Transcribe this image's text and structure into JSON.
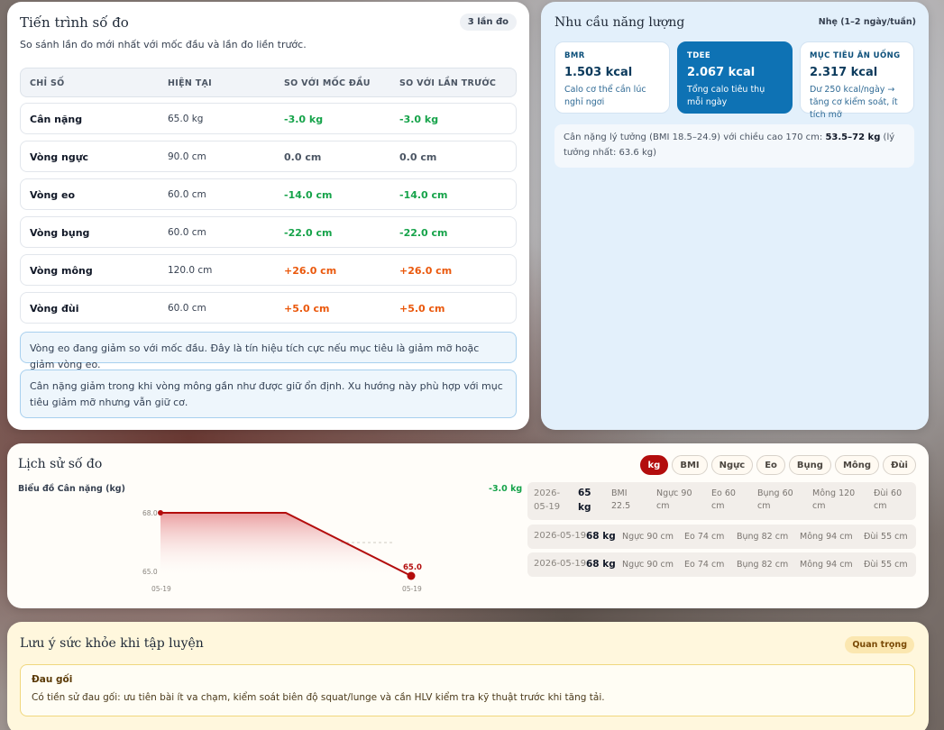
{
  "progress": {
    "title": "Tiến trình số đo",
    "badge": "3 lần đo",
    "subtitle": "So sánh lần đo mới nhất với mốc đầu và lần đo liền trước.",
    "headers": [
      "CHỈ SỐ",
      "HIỆN TẠI",
      "SO VỚI MỐC ĐẦU",
      "SO VỚI LẦN TRƯỚC"
    ],
    "rows": [
      {
        "name": "Cân nặng",
        "current": "65.0 kg",
        "vs_start": "-3.0 kg",
        "vs_prev": "-3.0 kg",
        "trend": "neg"
      },
      {
        "name": "Vòng ngực",
        "current": "90.0 cm",
        "vs_start": "0.0 cm",
        "vs_prev": "0.0 cm",
        "trend": "zero"
      },
      {
        "name": "Vòng eo",
        "current": "60.0 cm",
        "vs_start": "-14.0 cm",
        "vs_prev": "-14.0 cm",
        "trend": "neg"
      },
      {
        "name": "Vòng bụng",
        "current": "60.0 cm",
        "vs_start": "-22.0 cm",
        "vs_prev": "-22.0 cm",
        "trend": "neg"
      },
      {
        "name": "Vòng mông",
        "current": "120.0 cm",
        "vs_start": "+26.0 cm",
        "vs_prev": "+26.0 cm",
        "trend": "pos"
      },
      {
        "name": "Vòng đùi",
        "current": "60.0 cm",
        "vs_start": "+5.0 cm",
        "vs_prev": "+5.0 cm",
        "trend": "pos"
      }
    ],
    "notes": [
      "Vòng eo đang giảm so với mốc đầu. Đây là tín hiệu tích cực nếu mục tiêu là giảm mỡ hoặc giảm vòng eo.",
      "Cân nặng giảm trong khi vòng mông gần như được giữ ổn định. Xu hướng này phù hợp với mục tiêu giảm mỡ nhưng vẫn giữ cơ."
    ]
  },
  "energy": {
    "title": "Nhu cầu năng lượng",
    "level": "Nhẹ (1–2 ngày/tuần)",
    "boxes": [
      {
        "label": "BMR",
        "value": "1.503 kcal",
        "desc": "Calo cơ thể cần lúc nghỉ ngơi",
        "active": false
      },
      {
        "label": "TDEE",
        "value": "2.067 kcal",
        "desc": "Tổng calo tiêu thụ mỗi ngày",
        "active": true
      },
      {
        "label": "MỤC TIÊU ĂN UỐNG",
        "value": "2.317 kcal",
        "desc": "Dư 250 kcal/ngày → tăng cơ kiểm soát, ít tích mỡ",
        "active": false
      }
    ],
    "ideal_prefix": "Cân nặng lý tưởng (BMI 18.5–24.9) với chiều cao 170 cm: ",
    "ideal_range": "53.5–72 kg",
    "ideal_suffix": " (lý tưởng nhất: 63.6 kg)"
  },
  "history": {
    "title": "Lịch sử số đo",
    "chips": [
      "kg",
      "BMI",
      "Ngực",
      "Eo",
      "Bụng",
      "Mông",
      "Đùi"
    ],
    "active_chip": "kg",
    "chart_label": "Biểu đồ Cân nặng (kg)",
    "chart_delta": "-3.0 kg",
    "entries": [
      {
        "date": "2026-05-19",
        "weight": "65 kg",
        "bmi": "BMI 22.5",
        "chest": "Ngực 90 cm",
        "waist": "Eo 60 cm",
        "belly": "Bụng 60 cm",
        "hip": "Mông 120 cm",
        "thigh": "Đùi 60 cm"
      },
      {
        "date": "2026-05-19",
        "weight": "68 kg",
        "chest": "Ngực 90 cm",
        "waist": "Eo 74 cm",
        "belly": "Bụng 82 cm",
        "hip": "Mông 94 cm",
        "thigh": "Đùi 55 cm"
      },
      {
        "date": "2026-05-19",
        "weight": "68 kg",
        "chest": "Ngực 90 cm",
        "waist": "Eo 74 cm",
        "belly": "Bụng 82 cm",
        "hip": "Mông 94 cm",
        "thigh": "Đùi 55 cm"
      }
    ]
  },
  "chart_data": {
    "type": "area",
    "x": [
      "05-19",
      "05-19",
      "05-19"
    ],
    "x_tick_labels": [
      "05-19",
      "05-19"
    ],
    "values": [
      68.0,
      68.0,
      65.0
    ],
    "ytick_labels": [
      "68.0",
      "65.0"
    ],
    "point_labels": [
      null,
      null,
      "65.0"
    ],
    "ylim": [
      65.0,
      68.0
    ],
    "line_color": "#b30d0d",
    "title": "Biểu đồ Cân nặng (kg)"
  },
  "health": {
    "title": "Lưu ý sức khỏe khi tập luyện",
    "badge": "Quan trọng",
    "warn_title": "Đau gối",
    "warn_desc": "Có tiền sử đau gối: ưu tiên bài ít va chạm, kiểm soát biên độ squat/lunge và cần HLV kiểm tra kỹ thuật trước khi tăng tải."
  },
  "colors": {
    "accent_red": "#b30d0d",
    "accent_blue": "#0e72b4",
    "negative": "#16a34a",
    "positive": "#ea580c"
  }
}
